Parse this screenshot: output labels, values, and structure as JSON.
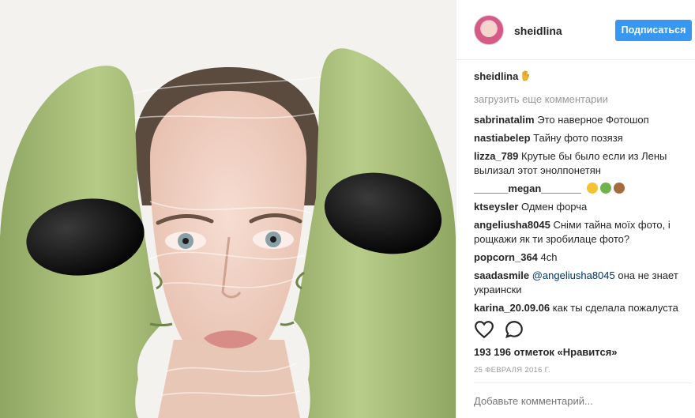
{
  "header": {
    "username": "sheidlina",
    "follow_label": "Подписаться"
  },
  "caption": {
    "username": "sheidlina"
  },
  "load_more": "загрузить еще комментарии",
  "comments": [
    {
      "user": "sabrinatalim",
      "text": "Это наверное Фотошоп"
    },
    {
      "user": "nastiabelep",
      "text": "Тайну фото позязя"
    },
    {
      "user": "lizza_789",
      "text": "Крутые бы было если из Лены вылизал этот энолпонетян"
    },
    {
      "user": "______megan_______",
      "text": ""
    },
    {
      "user": "ktseysler",
      "text": "Одмен форча"
    },
    {
      "user": "angeliusha8045",
      "text": "Сніми тайна моїх фото, і рощкажи як ти зробилаце фото?"
    },
    {
      "user": "popcorn_364",
      "text": "4ch"
    },
    {
      "user": "saadasmile",
      "mention": "@angeliusha8045",
      "text": "она не знает украински"
    },
    {
      "user": "karina_20.09.06",
      "text": "как ты сделала пожалуста"
    }
  ],
  "likes": "193 196 отметок «Нравится»",
  "date": "25 ФЕВРАЛЯ 2016 Г.",
  "add_comment_placeholder": "Добавьте комментарий...",
  "icons": {
    "like": "heart-icon",
    "comment": "comment-icon"
  },
  "colors": {
    "accent": "#3897f0",
    "alien_green": "#a8bf77",
    "muted": "#999999"
  }
}
